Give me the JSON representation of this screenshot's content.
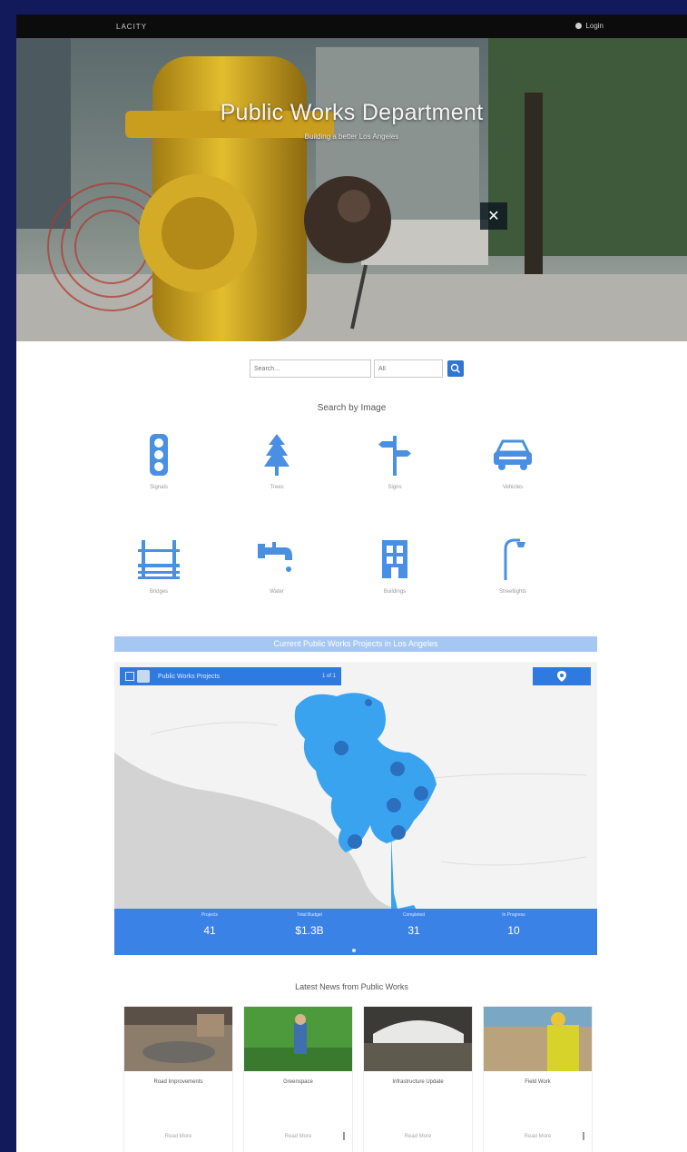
{
  "topbar": {
    "brand": "LACITY",
    "account_label": "Login",
    "user_icon": "user-icon"
  },
  "hero": {
    "title": "Public Works Department",
    "subtitle": "Building a better Los Angeles",
    "close_label": "✕"
  },
  "search": {
    "keyword_placeholder": "Search...",
    "location_placeholder": "All",
    "button_icon": "search-icon"
  },
  "services": {
    "heading": "Search by Image",
    "items": [
      {
        "label": "Signals",
        "icon": "traffic-light-icon"
      },
      {
        "label": "Trees",
        "icon": "tree-icon"
      },
      {
        "label": "Signs",
        "icon": "street-sign-icon"
      },
      {
        "label": "Vehicles",
        "icon": "vehicle-icon"
      },
      {
        "label": "Bridges",
        "icon": "bridge-icon"
      },
      {
        "label": "Water",
        "icon": "faucet-icon"
      },
      {
        "label": "Buildings",
        "icon": "building-icon"
      },
      {
        "label": "Streetlights",
        "icon": "streetlight-icon"
      }
    ]
  },
  "map": {
    "banner": "Current Public Works Projects in Los Angeles",
    "toolbar_title": "Public Works Projects",
    "toolbar_count": "1 of 1",
    "action_icon": "map-pin-icon",
    "stats": [
      {
        "label": "Projects",
        "value": "41"
      },
      {
        "label": "Total Budget",
        "value": "$1.3B"
      },
      {
        "label": "Completed",
        "value": "31"
      },
      {
        "label": "In Progress",
        "value": "10"
      }
    ],
    "colors": {
      "coverage": "#3aa3f0",
      "land": "#f3f3f3",
      "water": "#d3d3d3",
      "stats_bar": "#3b82e6"
    }
  },
  "news": {
    "heading": "Latest News from Public Works",
    "cards": [
      {
        "title": "Road Improvements",
        "footer": "Read More"
      },
      {
        "title": "Greenspace",
        "footer": "Read More"
      },
      {
        "title": "Infrastructure Update",
        "footer": "Read More"
      },
      {
        "title": "Field Work",
        "footer": "Read More"
      }
    ]
  }
}
